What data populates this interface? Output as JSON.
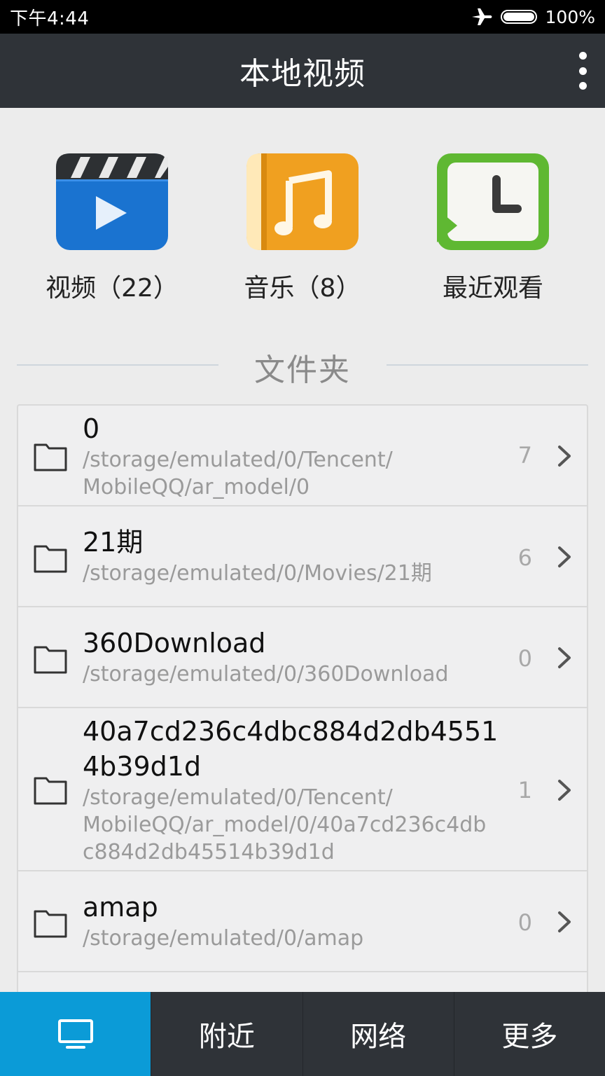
{
  "status_bar": {
    "time": "下午4:44",
    "battery": "100%"
  },
  "app_bar": {
    "title": "本地视频"
  },
  "shortcuts": [
    {
      "label": "视频（22）",
      "icon": "video-icon"
    },
    {
      "label": "音乐（8）",
      "icon": "music-icon"
    },
    {
      "label": "最近观看",
      "icon": "recent-clock-icon"
    }
  ],
  "folders_section": {
    "title": "文件夹"
  },
  "folders": [
    {
      "name": "0",
      "path": "/storage/emulated/0/Tencent/\nMobileQQ/ar_model/0",
      "count": "7"
    },
    {
      "name": "21期",
      "path": "/storage/emulated/0/Movies/21期",
      "count": "6"
    },
    {
      "name": "360Download",
      "path": "/storage/emulated/0/360Download",
      "count": "0"
    },
    {
      "name": "40a7cd236c4dbc884d2db4551\n4b39d1d",
      "path": "/storage/emulated/0/Tencent/\nMobileQQ/ar_model/0/40a7cd236c4db\nc884d2db45514b39d1d",
      "count": "1"
    },
    {
      "name": "amap",
      "path": "/storage/emulated/0/amap",
      "count": "0"
    }
  ],
  "bottom_nav": {
    "tabs": [
      {
        "label": "",
        "icon": "monitor-icon",
        "active": true
      },
      {
        "label": "附近"
      },
      {
        "label": "网络"
      },
      {
        "label": "更多"
      }
    ]
  },
  "colors": {
    "app_bar": "#2f3338",
    "active_tab": "#0b9bd7",
    "background": "#ececec",
    "video_icon": "#1a73d0",
    "music_icon": "#f0a020",
    "recent_icon": "#5fb832"
  }
}
